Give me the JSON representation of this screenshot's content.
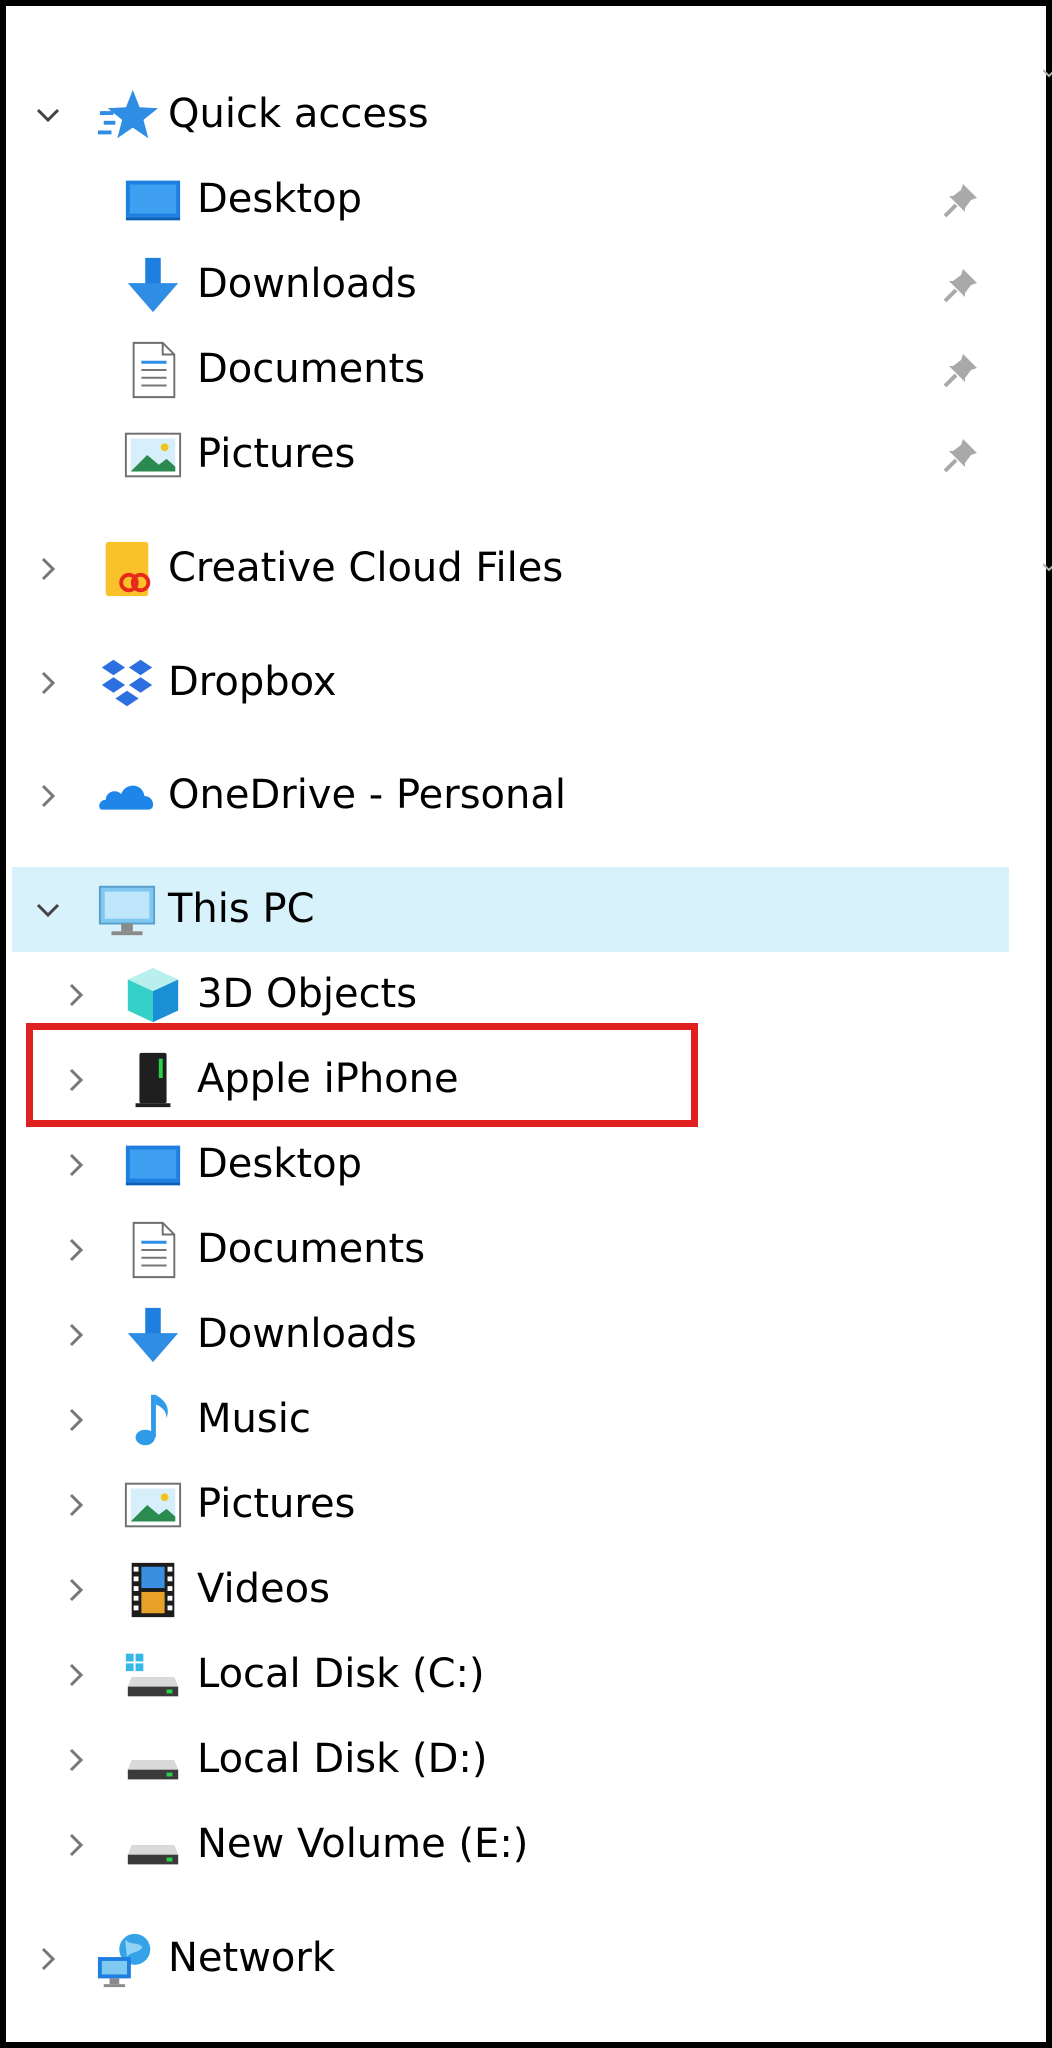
{
  "nav_pane": {
    "quick_access": {
      "label": "Quick access",
      "icon": "star-icon",
      "expanded": true,
      "items": [
        {
          "label": "Desktop",
          "icon": "desktop-icon",
          "pinned": true
        },
        {
          "label": "Downloads",
          "icon": "downloads-icon",
          "pinned": true
        },
        {
          "label": "Documents",
          "icon": "documents-icon",
          "pinned": true
        },
        {
          "label": "Pictures",
          "icon": "pictures-icon",
          "pinned": true
        }
      ]
    },
    "creative_cloud": {
      "label": "Creative Cloud Files",
      "icon": "creative-cloud-icon",
      "expanded": false
    },
    "dropbox": {
      "label": "Dropbox",
      "icon": "dropbox-icon",
      "expanded": false
    },
    "onedrive": {
      "label": "OneDrive - Personal",
      "icon": "onedrive-icon",
      "expanded": false
    },
    "this_pc": {
      "label": "This PC",
      "icon": "computer-icon",
      "expanded": true,
      "selected": true,
      "items": [
        {
          "label": "3D Objects",
          "icon": "cube-icon"
        },
        {
          "label": "Apple iPhone",
          "icon": "iphone-icon",
          "highlighted": true
        },
        {
          "label": "Desktop",
          "icon": "desktop-icon"
        },
        {
          "label": "Documents",
          "icon": "documents-icon"
        },
        {
          "label": "Downloads",
          "icon": "downloads-icon"
        },
        {
          "label": "Music",
          "icon": "music-icon"
        },
        {
          "label": "Pictures",
          "icon": "pictures-icon"
        },
        {
          "label": "Videos",
          "icon": "videos-icon"
        },
        {
          "label": "Local Disk (C:)",
          "icon": "system-drive-icon"
        },
        {
          "label": "Local Disk (D:)",
          "icon": "drive-icon"
        },
        {
          "label": "New Volume (E:)",
          "icon": "drive-icon"
        }
      ]
    },
    "network": {
      "label": "Network",
      "icon": "network-icon",
      "expanded": false
    }
  },
  "colors": {
    "selection_background": "#d8f2fb",
    "highlight_box": "#e0201f",
    "border": "#000000"
  }
}
